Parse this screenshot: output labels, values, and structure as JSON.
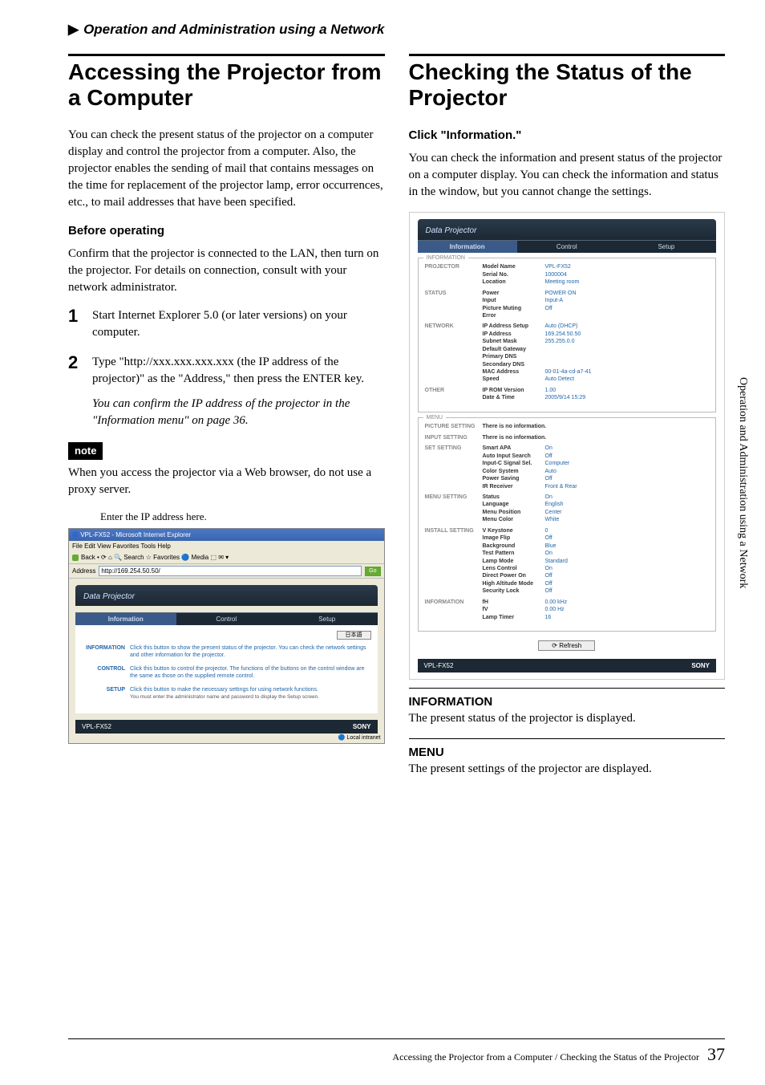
{
  "breadcrumb": "Operation and Administration using a Network",
  "left": {
    "title": "Accessing the Projector from a Computer",
    "intro": "You can check the present status of the projector on a computer display and control the projector from a computer. Also, the projector enables the sending of mail that contains messages on the time for replacement of the projector lamp, error occurrences, etc., to mail addresses that have been specified.",
    "before_h": "Before operating",
    "before_p": "Confirm that the projector is connected to the LAN, then turn on the projector. For details on connection, consult with your network administrator.",
    "step1": "Start Internet Explorer 5.0 (or later versions) on your computer.",
    "step2": "Type \"http://xxx.xxx.xxx.xxx (the IP address of the projector)\" as the \"Address,\" then press the ENTER key.",
    "step2_note": "You can confirm the IP address of the projector in the \"Information menu\" on page 36.",
    "note_label": "note",
    "note_body": "When you access the projector via a Web browser, do not use a proxy server.",
    "caption": "Enter the IP address here.",
    "browser": {
      "title": "VPL-FX52 - Microsoft Internet Explorer",
      "menus": "File  Edit  View  Favorites  Tools  Help",
      "toolbar": "Back  •   ⟳  ⌂  🔍 Search  ☆ Favorites  🔵 Media  ⬚  ✉ ▾",
      "addr_label": "Address",
      "addr_value": "http://169.254.50.50/",
      "go": "Go",
      "banner": "Data Projector",
      "tabs": {
        "info": "Information",
        "control": "Control",
        "setup": "Setup"
      },
      "lang": "日本語",
      "rows": [
        {
          "lbl": "INFORMATION",
          "desc": "Click this button to show the present status of the projector. You can check the network settings and other information for the projector."
        },
        {
          "lbl": "CONTROL",
          "desc": "Click this button to control the projector. The functions of the buttons on the control window are the same as those on the supplied remote control."
        },
        {
          "lbl": "SETUP",
          "desc": "Click this button to make the necessary settings for using network functions.",
          "sub": "You must enter the administrator name and password to display the Setup screen."
        }
      ],
      "footer_model": "VPL-FX52",
      "footer_brand": "SONY",
      "statusbar": "Local intranet"
    }
  },
  "right": {
    "title": "Checking the Status of the Projector",
    "click_h": "Click \"Information.\"",
    "click_p": "You can check the information and present status of the projector on a computer display. You can check the information and status in the window, but you cannot change the settings.",
    "info_hdr": "INFORMATION",
    "info_body": "The present status of the projector is displayed.",
    "menu_hdr": "MENU",
    "menu_body": "The present settings of the projector are displayed.",
    "shot": {
      "banner": "Data Projector",
      "tabs": {
        "info": "Information",
        "control": "Control",
        "setup": "Setup"
      },
      "sections": {
        "information": {
          "legend": "INFORMATION",
          "groups": [
            {
              "k": "PROJECTOR",
              "pairs": [
                [
                  "Model Name",
                  "VPL-FX52"
                ],
                [
                  "Serial No.",
                  "1000004"
                ],
                [
                  "Location",
                  "Meeting room"
                ]
              ]
            },
            {
              "k": "STATUS",
              "pairs": [
                [
                  "Power",
                  "POWER ON"
                ],
                [
                  "Input",
                  "Input-A"
                ],
                [
                  "Picture Muting",
                  "Off"
                ],
                [
                  "Error",
                  ""
                ]
              ]
            },
            {
              "k": "NETWORK",
              "pairs": [
                [
                  "IP Address Setup",
                  "Auto (DHCP)"
                ],
                [
                  "IP Address",
                  "169.254.50.50"
                ],
                [
                  "Subnet Mask",
                  "255.255.0.0"
                ],
                [
                  "Default Gateway",
                  ""
                ],
                [
                  "Primary DNS",
                  ""
                ],
                [
                  "Secondary DNS",
                  ""
                ],
                [
                  "MAC Address",
                  "00-01-4a-cd-a7-41"
                ],
                [
                  "Speed",
                  "Auto Detect"
                ]
              ]
            },
            {
              "k": "OTHER",
              "pairs": [
                [
                  "IP ROM Version",
                  "1.00"
                ],
                [
                  "Date & Time",
                  "2005/9/14 15:29"
                ]
              ]
            }
          ]
        },
        "menu": {
          "legend": "MENU",
          "groups": [
            {
              "k": "PICTURE SETTING",
              "noinfo": "There is no information."
            },
            {
              "k": "INPUT SETTING",
              "noinfo": "There is no information."
            },
            {
              "k": "SET SETTING",
              "pairs": [
                [
                  "Smart APA",
                  "On"
                ],
                [
                  "Auto Input Search",
                  "Off"
                ],
                [
                  "Input-C Signal Sel.",
                  "Computer"
                ],
                [
                  "Color System",
                  "Auto"
                ],
                [
                  "Power Saving",
                  "Off"
                ],
                [
                  "IR Receiver",
                  "Front & Rear"
                ]
              ]
            },
            {
              "k": "MENU SETTING",
              "pairs": [
                [
                  "Status",
                  "On"
                ],
                [
                  "Language",
                  "English"
                ],
                [
                  "Menu Position",
                  "Center"
                ],
                [
                  "Menu Color",
                  "White"
                ]
              ]
            },
            {
              "k": "INSTALL SETTING",
              "pairs": [
                [
                  "V Keystone",
                  "0"
                ],
                [
                  "Image Flip",
                  "Off"
                ],
                [
                  "Background",
                  "Blue"
                ],
                [
                  "Test Pattern",
                  "On"
                ],
                [
                  "Lamp Mode",
                  "Standard"
                ],
                [
                  "Lens Control",
                  "On"
                ],
                [
                  "Direct Power On",
                  "Off"
                ],
                [
                  "High Altitude Mode",
                  "Off"
                ],
                [
                  "Security Lock",
                  "Off"
                ]
              ]
            },
            {
              "k": "INFORMATION",
              "pairs": [
                [
                  "fH",
                  "0.00 kHz"
                ],
                [
                  "fV",
                  "0.00 Hz"
                ],
                [
                  "Lamp Timer",
                  "16"
                ]
              ]
            }
          ]
        }
      },
      "refresh": "Refresh",
      "footer_model": "VPL-FX52",
      "footer_brand": "SONY"
    }
  },
  "vtext": "Operation and Administration using a Network",
  "footer_text": "Accessing the Projector from a Computer / Checking the Status of the Projector",
  "page_number": "37"
}
